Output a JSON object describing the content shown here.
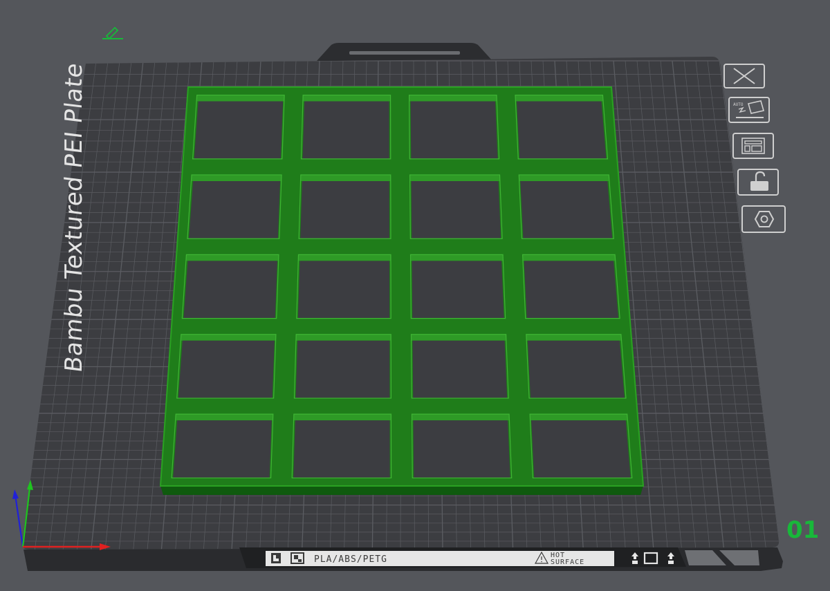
{
  "plate": {
    "label": "Bambu Textured PEI Plate",
    "number": "01"
  },
  "strip": {
    "materials": "PLA/ABS/PETG",
    "warning_line1": "HOT",
    "warning_line2": "SURFACE"
  },
  "model": {
    "type": "grid-tray",
    "columns": 4,
    "rows": 5,
    "color": "#1f7d1a"
  },
  "toolbar": {
    "buttons": [
      {
        "name": "close-plate-button",
        "icon": "close-icon"
      },
      {
        "name": "auto-orient-button",
        "icon": "auto-orient-icon",
        "label": "AUTO"
      },
      {
        "name": "arrange-button",
        "icon": "arrange-icon"
      },
      {
        "name": "lock-plate-button",
        "icon": "lock-icon"
      },
      {
        "name": "plate-settings-button",
        "icon": "hex-nut-icon"
      }
    ]
  },
  "colors": {
    "background": "#54565b",
    "plate": "#3c3d41",
    "grid": "#5b5d62",
    "model": "#1f7d1a",
    "accent": "#18b83a",
    "axis_x": "#e02020",
    "axis_y": "#1fc41f",
    "axis_z": "#2020d8"
  }
}
